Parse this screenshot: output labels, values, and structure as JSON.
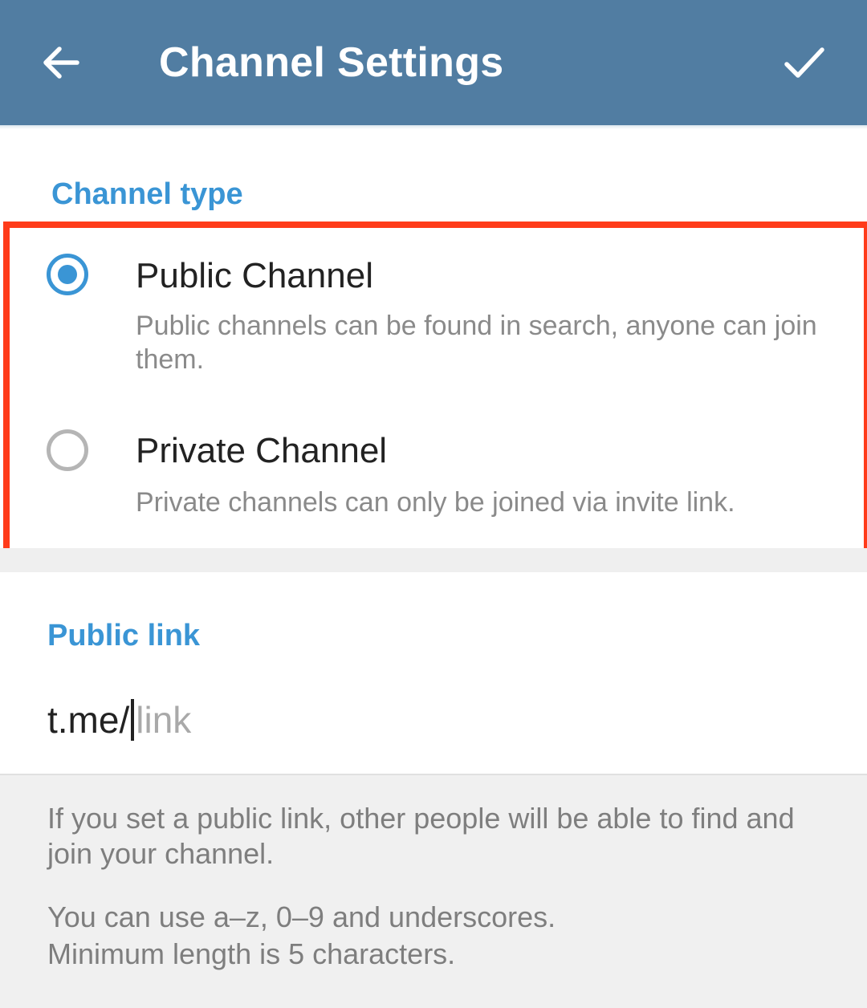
{
  "appbar": {
    "title": "Channel Settings",
    "back_icon": "arrow-left-icon",
    "confirm_icon": "checkmark-icon",
    "background_color": "#517da2"
  },
  "channel_type": {
    "header": "Channel type",
    "highlight_color": "#ff3b1a",
    "options": [
      {
        "title": "Public Channel",
        "description": "Public channels can be found in search, anyone can join them.",
        "selected": true
      },
      {
        "title": "Private Channel",
        "description": "Private channels can only be joined via invite link.",
        "selected": false
      }
    ]
  },
  "public_link": {
    "header": "Public link",
    "prefix": "t.me/",
    "value": "",
    "placeholder": "link"
  },
  "footer": {
    "hint_1": "If you set a public link, other people will be able to find and join your channel.",
    "hint_2_line_1": "You can use a–z, 0–9 and underscores.",
    "hint_2_line_2": "Minimum length is 5 characters."
  },
  "colors": {
    "accent": "#3a95d5",
    "radio_unselected": "#b5b5b5"
  }
}
